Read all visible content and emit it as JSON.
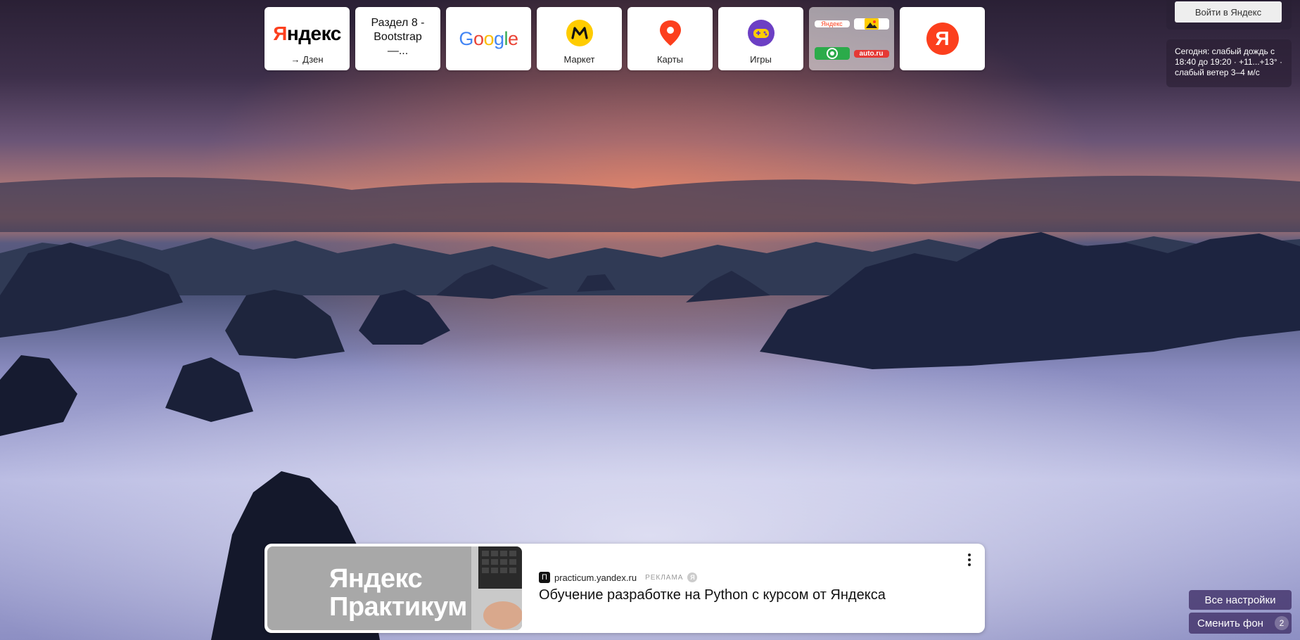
{
  "tiles": [
    {
      "id": "yandex-dzen",
      "caption": "→ Дзен",
      "logo_text_red": "Я",
      "logo_text_black": "ндекс"
    },
    {
      "id": "bootstrap",
      "text": "Раздел 8 - Bootstrap —..."
    },
    {
      "id": "google",
      "logo_text": "Google"
    },
    {
      "id": "market",
      "caption": "Маркет"
    },
    {
      "id": "maps",
      "caption": "Карты"
    },
    {
      "id": "games",
      "caption": "Игры"
    },
    {
      "id": "group",
      "mini": [
        "Яндекс",
        "",
        "",
        "auto.ru"
      ]
    },
    {
      "id": "yandex",
      "logo_letter": "Я"
    }
  ],
  "header": {
    "login_label": "Войти в Яндекс",
    "weather_text": "Сегодня: слабый дождь с 18:40 до 19:20 · +11...+13° · слабый ветер 3–4 м/с"
  },
  "ad": {
    "image_text_line1": "Яндекс",
    "image_text_line2": "Практикум",
    "favicon_letter": "П",
    "domain": "practicum.yandex.ru",
    "label": "РЕКЛАМА",
    "badge": "Я",
    "title": "Обучение разработке на Python с курсом от Яндекса"
  },
  "footer": {
    "settings_label": "Все настройки",
    "change_bg_label": "Сменить фон",
    "change_bg_count": "2"
  },
  "colors": {
    "yandex_red": "#fc3f1d",
    "market_yellow": "#ffcc00",
    "games_purple": "#6c3fc4",
    "dark_button": "#46376e"
  }
}
